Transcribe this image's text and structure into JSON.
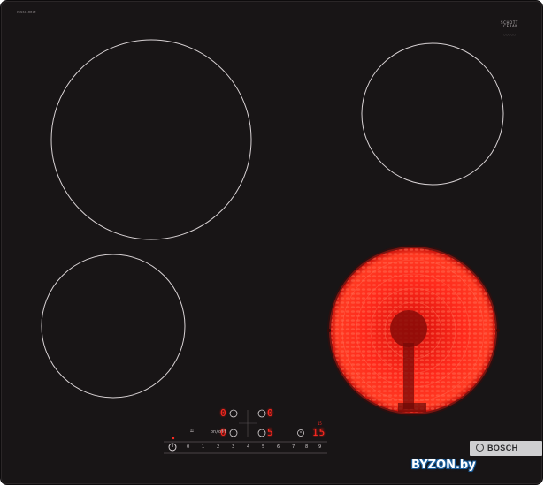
{
  "product": {
    "model_code": "PKN611BB1E",
    "glass_brand_line1": "SCHOTT",
    "glass_brand_line2": "CERAN",
    "glass_brand_sub": "◌◌◌◌◌",
    "brand": "BOSCH"
  },
  "zones": [
    {
      "id": "rear-left",
      "state": "off"
    },
    {
      "id": "rear-right",
      "state": "off"
    },
    {
      "id": "front-left",
      "state": "off"
    },
    {
      "id": "front-right",
      "state": "heating"
    }
  ],
  "control_panel": {
    "rear_left_display": "0",
    "rear_right_display": "0",
    "front_left_display": "0",
    "front_right_display": "5",
    "timer_display": "15",
    "timer_marker": "15",
    "lock_label": "on/off",
    "child_lock_label": "⚿",
    "power_icon": "power-icon",
    "scale": [
      "0",
      "1",
      "2",
      "3",
      "4",
      "5",
      "6",
      "7",
      "8",
      "9"
    ]
  },
  "watermark": "BYZON.by",
  "colors": {
    "glass": "#181516",
    "zone_outline": "#d8d2d4",
    "heater_red": "#ff2418",
    "display_red": "#ff2a22"
  }
}
